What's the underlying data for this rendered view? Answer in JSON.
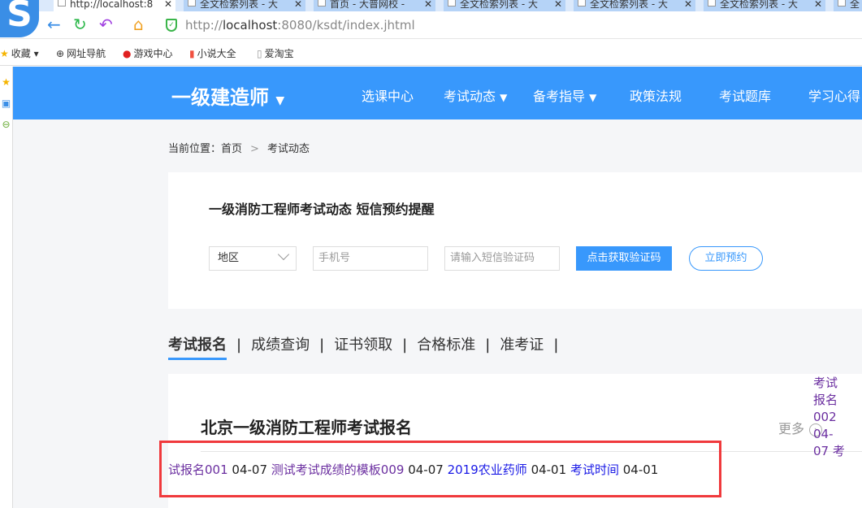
{
  "browser": {
    "tabs": [
      {
        "title": "http://localhost:8",
        "active": true
      },
      {
        "title": "全文检索列表 - 大"
      },
      {
        "title": "首页 - 大普网校 -"
      },
      {
        "title": "全文检索列表 - 大"
      },
      {
        "title": "全文检索列表 - 大"
      },
      {
        "title": "全文检索列表 - 大"
      },
      {
        "title": "全"
      }
    ],
    "url_prefix": "http://",
    "url_host": "localhost",
    "url_rest": ":8080/ksdt/index.jhtml",
    "bookmarks": [
      "收藏",
      "网址导航",
      "游戏中心",
      "小说大全",
      "爱淘宝"
    ]
  },
  "header": {
    "brand": "一级建造师",
    "nav": [
      "选课中心",
      "考试动态",
      "备考指导",
      "政策法规",
      "考试题库",
      "学习心得"
    ]
  },
  "breadcrumb": {
    "label": "当前位置：",
    "home": "首页",
    "sep": ">",
    "current": "考试动态"
  },
  "reminder": {
    "title": "一级消防工程师考试动态 短信预约提醒",
    "region": "地区",
    "phone_placeholder": "手机号",
    "code_placeholder": "请输入短信验证码",
    "get_code": "点击获取验证码",
    "book_now": "立即预约"
  },
  "tabs": [
    "考试报名",
    "成绩查询",
    "证书领取",
    "合格标准",
    "准考证"
  ],
  "section": {
    "title": "北京一级消防工程师考试报名",
    "more": "更多",
    "overflow_text": "考试报名002 04-07 考",
    "items": [
      {
        "title": "试报名001",
        "date": "04-07",
        "visited": true
      },
      {
        "title": "测试考试成绩的模板009",
        "date": "04-07",
        "visited": true
      },
      {
        "title": "2019农业药师",
        "date": "04-01",
        "visited": false
      },
      {
        "title": "考试时间",
        "date": "04-01",
        "visited": false
      }
    ]
  },
  "colors": {
    "brand": "#3898fc",
    "highlight": "#f0393c"
  }
}
